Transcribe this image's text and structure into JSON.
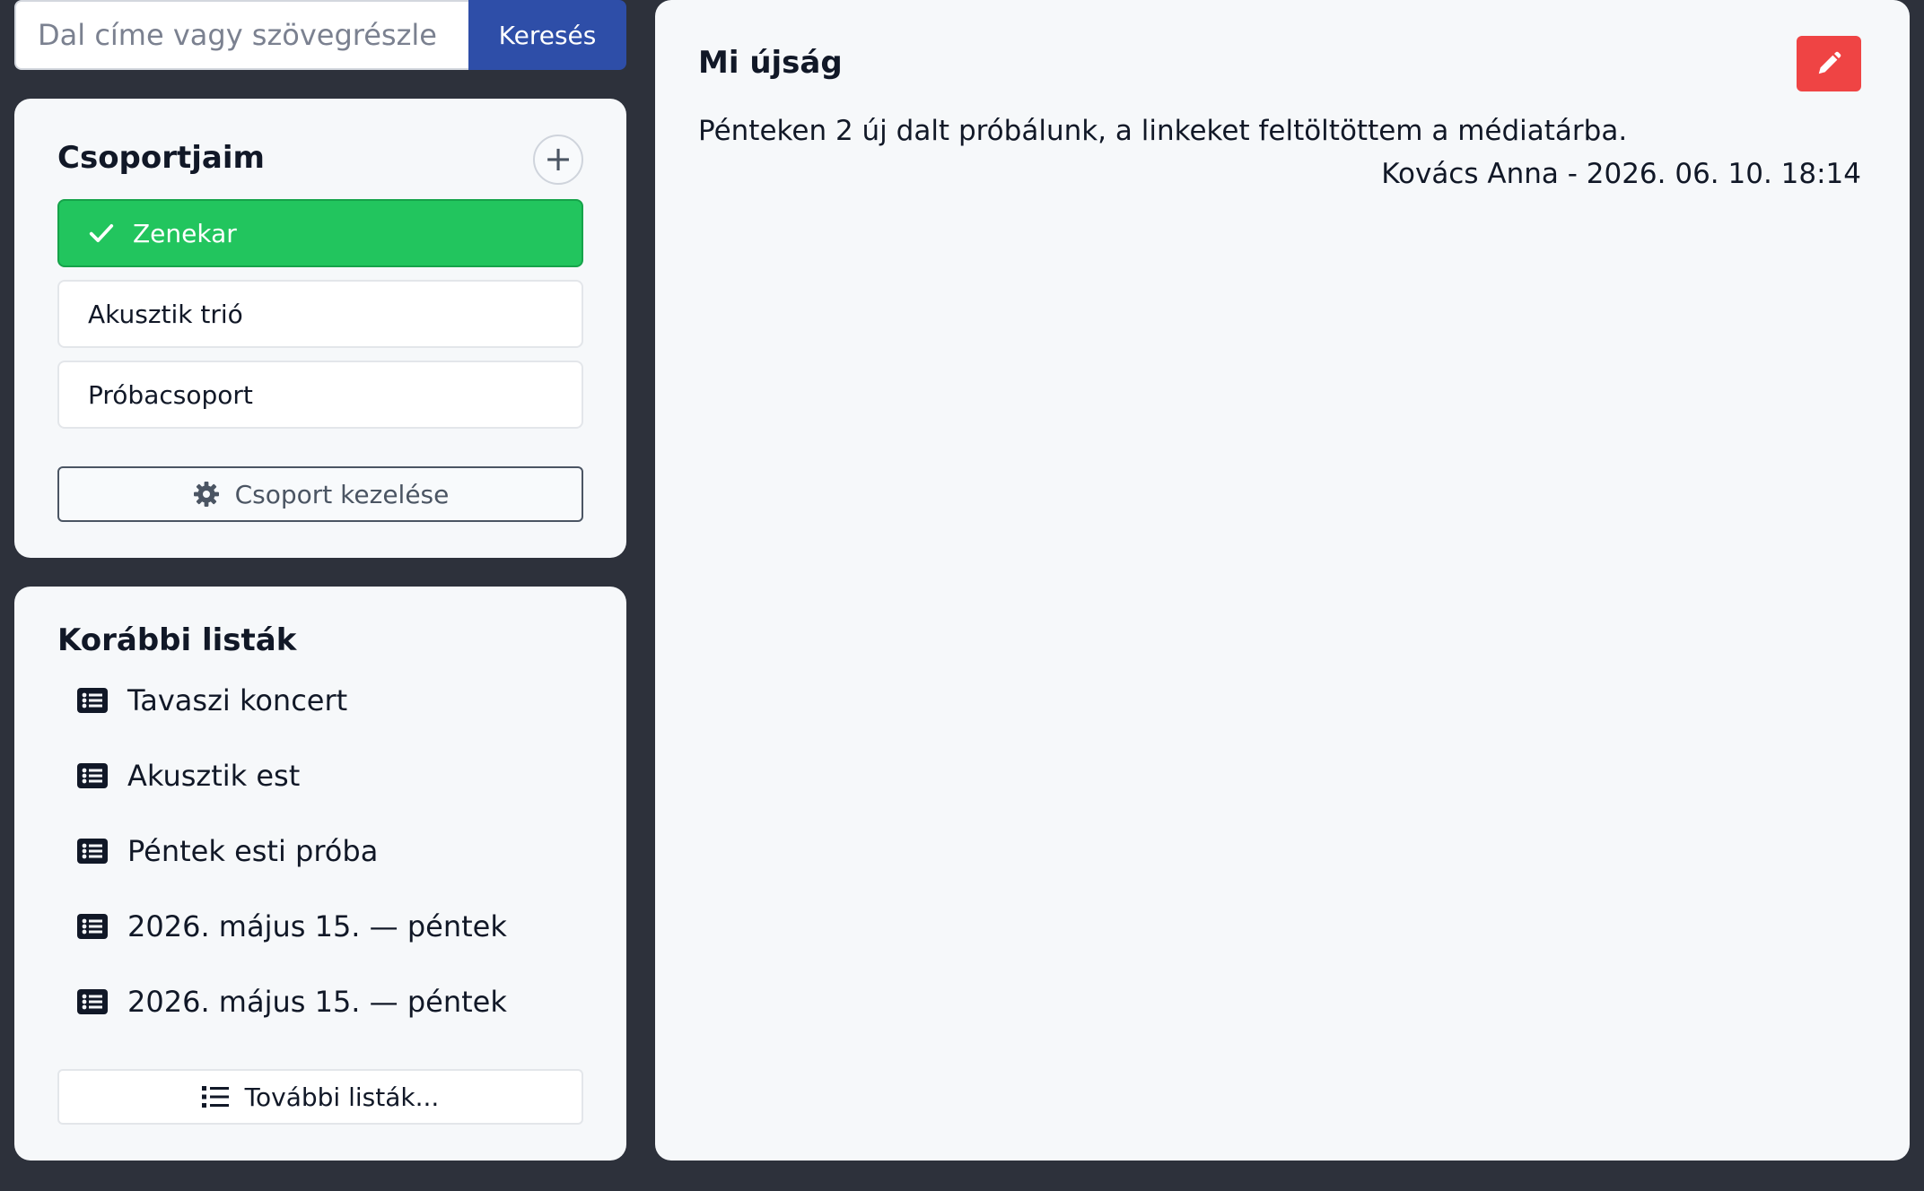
{
  "search": {
    "placeholder": "Dal címe vagy szövegrészle",
    "button_label": "Keresés"
  },
  "groups": {
    "title": "Csoportjaim",
    "add_icon": "plus-icon",
    "items": [
      {
        "label": "Zenekar",
        "active": true
      },
      {
        "label": "Akusztik trió",
        "active": false
      },
      {
        "label": "Próbacsoport",
        "active": false
      }
    ],
    "manage_label": "Csoport kezelése",
    "manage_icon": "gear-icon"
  },
  "lists": {
    "title": "Korábbi listák",
    "items": [
      {
        "label": "Tavaszi koncert"
      },
      {
        "label": "Akusztik est"
      },
      {
        "label": "Péntek esti próba"
      },
      {
        "label": "2026. május 15. — péntek"
      },
      {
        "label": "2026. május 15. — péntek"
      }
    ],
    "more_label": "További listák..."
  },
  "news": {
    "title": "Mi újság",
    "edit_icon": "pencil-icon",
    "message": "Pénteken 2 új dalt próbálunk, a linkeket feltöltöttem a médiatárba.",
    "meta": "Kovács Anna - 2026. 06. 10. 18:14"
  },
  "colors": {
    "background": "#2d313b",
    "card": "#f6f8fa",
    "primary": "#2e4ea8",
    "active_group": "#22c55e",
    "danger": "#ef4444"
  }
}
